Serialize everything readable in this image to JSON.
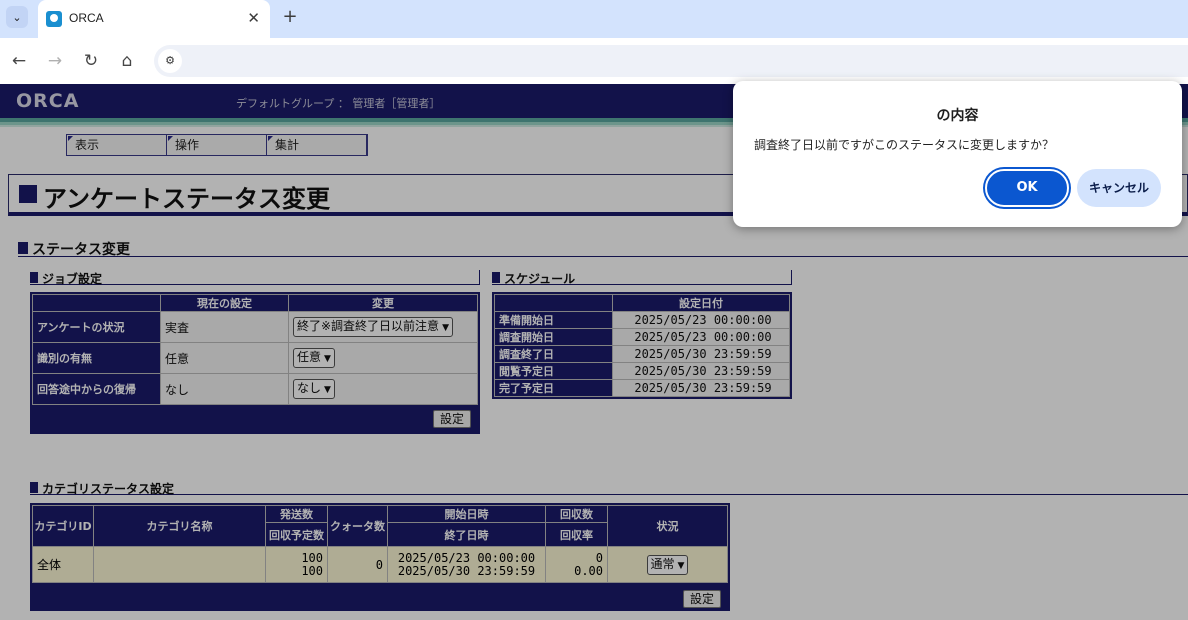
{
  "browser": {
    "tab_title": "ORCA",
    "tab_close": "✕",
    "new_tab": "+",
    "tab_menu": "⌄",
    "back": "←",
    "forward": "→",
    "reload": "↻",
    "home": "⌂",
    "site_info": "⚙"
  },
  "header": {
    "logo": "ORCA",
    "group": "デフォルトグループ ： 管理者［管理者］"
  },
  "menu": [
    "表示",
    "操作",
    "集計"
  ],
  "page_title": "アンケートステータス変更",
  "status_section": "ステータス変更",
  "job": {
    "title": "ジョブ設定",
    "col_current": "現在の設定",
    "col_change": "変更",
    "rows": [
      {
        "label": "アンケートの状況",
        "current": "実査",
        "change": "終了※調査終了日以前注意"
      },
      {
        "label": "識別の有無",
        "current": "任意",
        "change": "任意"
      },
      {
        "label": "回答途中からの復帰",
        "current": "なし",
        "change": "なし"
      }
    ],
    "set_button": "設定"
  },
  "schedule": {
    "title": "スケジュール",
    "col_date": "設定日付",
    "rows": [
      {
        "label": "準備開始日",
        "date": "2025/05/23 00:00:00"
      },
      {
        "label": "調査開始日",
        "date": "2025/05/23 00:00:00"
      },
      {
        "label": "調査終了日",
        "date": "2025/05/30 23:59:59"
      },
      {
        "label": "閲覧予定日",
        "date": "2025/05/30 23:59:59"
      },
      {
        "label": "完了予定日",
        "date": "2025/05/30 23:59:59"
      }
    ]
  },
  "category": {
    "title": "カテゴリステータス設定",
    "col_id": "カテゴリID",
    "col_name": "カテゴリ名称",
    "col_sent": "発送数",
    "col_expected": "回収予定数",
    "col_quota": "クォータ数",
    "col_start": "開始日時",
    "col_end": "終了日時",
    "col_collected": "回収数",
    "col_rate": "回収率",
    "col_status": "状況",
    "row": {
      "id": "全体",
      "name": "",
      "sent": "100",
      "expected": "100",
      "quota": "0",
      "start": "2025/05/23 00:00:00",
      "end": "2025/05/30 23:59:59",
      "collected": "0",
      "rate": "0.00",
      "status": "通常"
    },
    "set_button": "設定"
  },
  "dialog": {
    "title": "の内容",
    "message": "調査終了日以前ですがこのステータスに変更しますか？",
    "ok": "OK",
    "cancel": "キャンセル"
  },
  "colors": {
    "navy": "#1b1b6b",
    "accent": "#0b57d0"
  }
}
